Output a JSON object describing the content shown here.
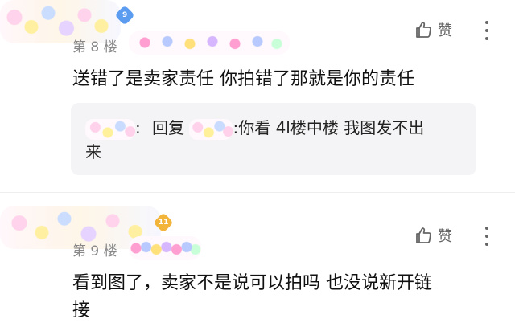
{
  "posts": [
    {
      "floor_label": "第 8 楼",
      "level": "9",
      "like_label": "赞",
      "body": "送错了是卖家责任 你拍错了那就是你的责任",
      "reply": {
        "prefix": ":",
        "reply_word": "回复",
        "text_line1": ":你看 4l楼中楼 我图发不出",
        "text_line2": "来"
      }
    },
    {
      "floor_label": "第 9 楼",
      "level": "11",
      "like_label": "赞",
      "body_line1": "看到图了，卖家不是说可以拍吗 也没说新开链",
      "body_line2": "接"
    }
  ],
  "colors": {
    "badge_level_9": "#5b9cf0",
    "badge_level_11": "#f3b43a",
    "floor_text": "#888888",
    "reply_bg": "#f4f4f6"
  },
  "icons": {
    "like": "thumbs-up-icon",
    "more": "more-vertical-icon"
  }
}
